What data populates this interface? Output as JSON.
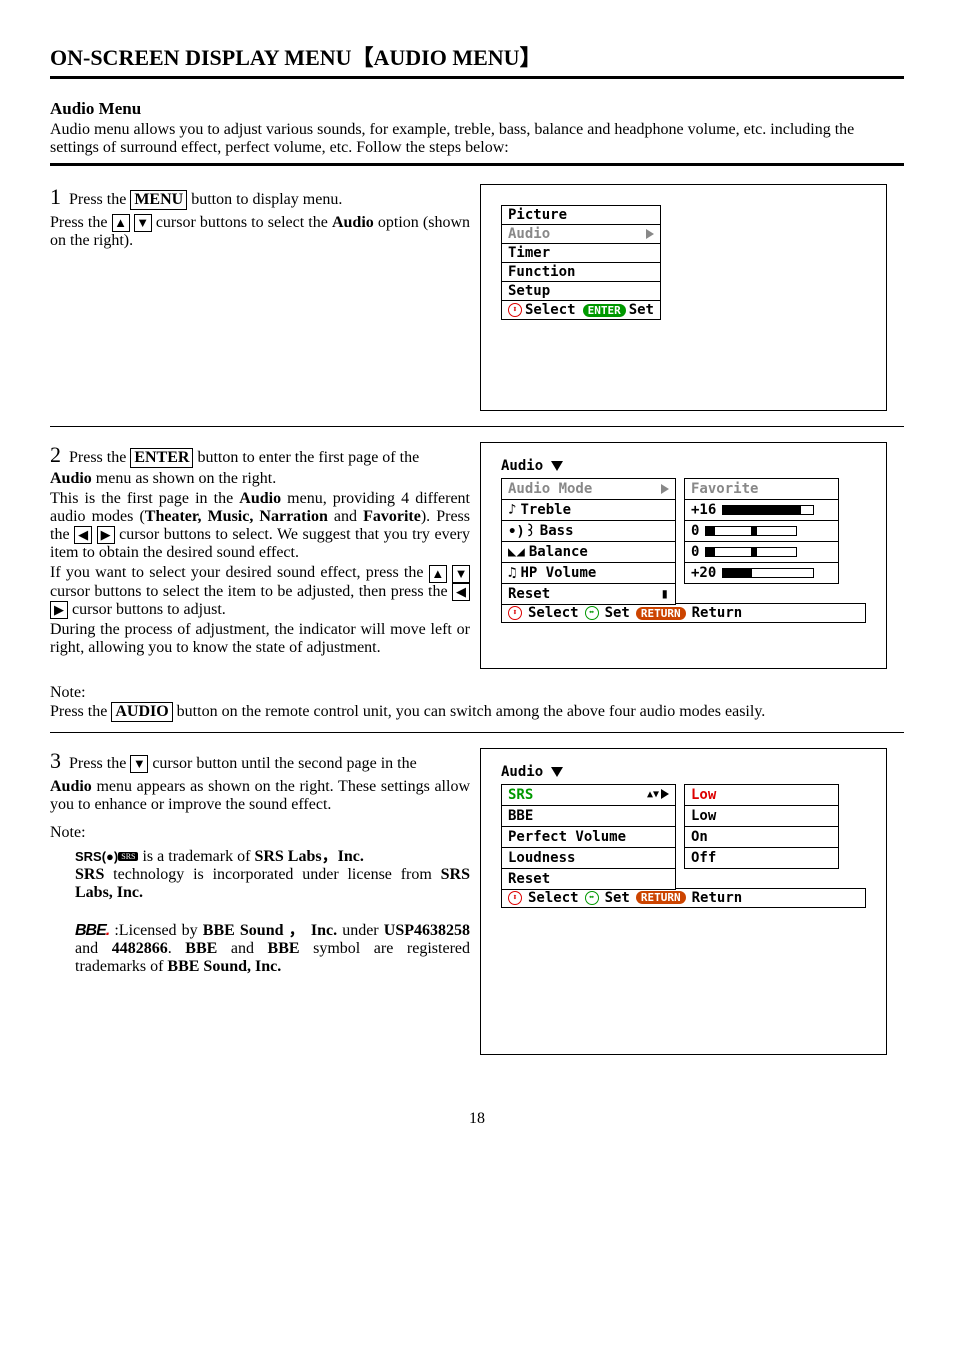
{
  "page_title": "ON-SCREEN DISPLAY MENU【AUDIO MENU】",
  "section_heading": "Audio Menu",
  "intro": "Audio menu allows you to adjust various sounds, for example, treble, bass, balance and headphone volume, etc. including the settings of surround effect, perfect volume, etc. Follow the steps below:",
  "step1": {
    "num": "1",
    "line1a": "Press the ",
    "menu_btn": "MENU",
    "line1b": " button to display menu.",
    "line2a": "Press the ",
    "line2b": " cursor buttons to select the ",
    "audio_word": "Audio",
    "line2c": " option (shown on the right).",
    "osd_items": [
      "Picture",
      "Audio",
      "Timer",
      "Function",
      "Setup"
    ],
    "osd_selected_index": 1,
    "hints_select": "Select",
    "hints_enter": "ENTER",
    "hints_set": "Set"
  },
  "step2": {
    "num": "2",
    "line1a": "Press the ",
    "enter_btn": "ENTER",
    "line1b": " button to enter the first page of the ",
    "line2a": "Audio",
    "line2b": " menu as shown on the right.",
    "para2": "This is the first page in the Audio menu, providing 4 different audio modes (Theater, Music, Narration and Favorite). Press the ◀ ▶ cursor buttons to select. We suggest that you try every item to obtain the desired sound effect.",
    "para3": "If you want to select your desired sound effect, press the ▲ ▼ cursor buttons to select the item to be adjusted, then press the ◀ ▶ cursor buttons to adjust.",
    "para4": "During the process of adjustment, the indicator will move left or right, allowing you to know the state of adjustment.",
    "osd_title": "Audio",
    "rows": [
      {
        "label": "Audio Mode",
        "value": "Favorite",
        "type": "text",
        "selected": true
      },
      {
        "label": "Treble",
        "value": "+16",
        "type": "slider",
        "fill": 80,
        "thumb": 80
      },
      {
        "label": "Bass",
        "value": "0",
        "type": "slider",
        "fill": 10,
        "thumb": 50
      },
      {
        "label": "Balance",
        "value": "0",
        "type": "slider",
        "fill": 10,
        "thumb": 50
      },
      {
        "label": "HP Volume",
        "value": "+20",
        "type": "slider",
        "fill": 25,
        "thumb": 25
      },
      {
        "label": "Reset",
        "value": "",
        "type": "none"
      }
    ],
    "hints_select": "Select",
    "hints_set": "Set",
    "hints_return_pill": "RETURN",
    "hints_return": "Return"
  },
  "note1": {
    "label": "Note:",
    "text_a": "Press the ",
    "audio_btn": "AUDIO",
    "text_b": " button on the remote control unit, you can switch among the above four audio modes easily."
  },
  "step3": {
    "num": "3",
    "line1a": "Press the ",
    "line1b": " cursor button until the second page in the ",
    "line2": "Audio menu appears as shown on the right. These settings allow you to enhance or improve the sound effect.",
    "note_label": "Note:",
    "srs_line": " is a trademark of SRS Labs，Inc.",
    "srs_tech": "SRS technology is incorporated under license from SRS Labs, Inc.",
    "bbe_line": " :Licensed by BBE Sound ， Inc. under USP4638258 and 4482866. BBE and BBE symbol are registered trademarks of BBE Sound, Inc.",
    "osd_title": "Audio",
    "rows": [
      {
        "label": "SRS",
        "value": "Low",
        "selected": true,
        "value_color": "#d00",
        "label_color": "#090"
      },
      {
        "label": "BBE",
        "value": "Low"
      },
      {
        "label": "Perfect Volume",
        "value": "On"
      },
      {
        "label": "Loudness",
        "value": "Off"
      },
      {
        "label": "Reset",
        "value": ""
      }
    ],
    "hints_select": "Select",
    "hints_set": "Set",
    "hints_return_pill": "RETURN",
    "hints_return": "Return"
  },
  "page_number": "18"
}
